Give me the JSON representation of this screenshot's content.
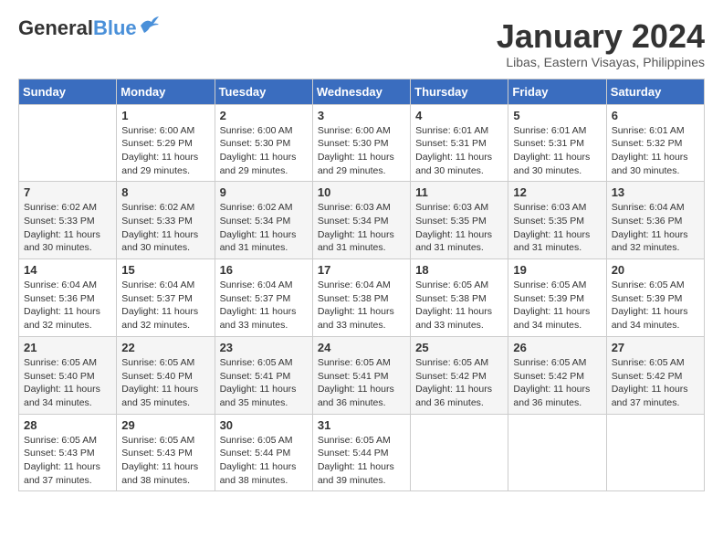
{
  "header": {
    "logo_general": "General",
    "logo_blue": "Blue",
    "month_title": "January 2024",
    "location": "Libas, Eastern Visayas, Philippines"
  },
  "weekdays": [
    "Sunday",
    "Monday",
    "Tuesday",
    "Wednesday",
    "Thursday",
    "Friday",
    "Saturday"
  ],
  "weeks": [
    [
      {
        "day": "",
        "info": ""
      },
      {
        "day": "1",
        "info": "Sunrise: 6:00 AM\nSunset: 5:29 PM\nDaylight: 11 hours\nand 29 minutes."
      },
      {
        "day": "2",
        "info": "Sunrise: 6:00 AM\nSunset: 5:30 PM\nDaylight: 11 hours\nand 29 minutes."
      },
      {
        "day": "3",
        "info": "Sunrise: 6:00 AM\nSunset: 5:30 PM\nDaylight: 11 hours\nand 29 minutes."
      },
      {
        "day": "4",
        "info": "Sunrise: 6:01 AM\nSunset: 5:31 PM\nDaylight: 11 hours\nand 30 minutes."
      },
      {
        "day": "5",
        "info": "Sunrise: 6:01 AM\nSunset: 5:31 PM\nDaylight: 11 hours\nand 30 minutes."
      },
      {
        "day": "6",
        "info": "Sunrise: 6:01 AM\nSunset: 5:32 PM\nDaylight: 11 hours\nand 30 minutes."
      }
    ],
    [
      {
        "day": "7",
        "info": "Sunrise: 6:02 AM\nSunset: 5:33 PM\nDaylight: 11 hours\nand 30 minutes."
      },
      {
        "day": "8",
        "info": "Sunrise: 6:02 AM\nSunset: 5:33 PM\nDaylight: 11 hours\nand 30 minutes."
      },
      {
        "day": "9",
        "info": "Sunrise: 6:02 AM\nSunset: 5:34 PM\nDaylight: 11 hours\nand 31 minutes."
      },
      {
        "day": "10",
        "info": "Sunrise: 6:03 AM\nSunset: 5:34 PM\nDaylight: 11 hours\nand 31 minutes."
      },
      {
        "day": "11",
        "info": "Sunrise: 6:03 AM\nSunset: 5:35 PM\nDaylight: 11 hours\nand 31 minutes."
      },
      {
        "day": "12",
        "info": "Sunrise: 6:03 AM\nSunset: 5:35 PM\nDaylight: 11 hours\nand 31 minutes."
      },
      {
        "day": "13",
        "info": "Sunrise: 6:04 AM\nSunset: 5:36 PM\nDaylight: 11 hours\nand 32 minutes."
      }
    ],
    [
      {
        "day": "14",
        "info": "Sunrise: 6:04 AM\nSunset: 5:36 PM\nDaylight: 11 hours\nand 32 minutes."
      },
      {
        "day": "15",
        "info": "Sunrise: 6:04 AM\nSunset: 5:37 PM\nDaylight: 11 hours\nand 32 minutes."
      },
      {
        "day": "16",
        "info": "Sunrise: 6:04 AM\nSunset: 5:37 PM\nDaylight: 11 hours\nand 33 minutes."
      },
      {
        "day": "17",
        "info": "Sunrise: 6:04 AM\nSunset: 5:38 PM\nDaylight: 11 hours\nand 33 minutes."
      },
      {
        "day": "18",
        "info": "Sunrise: 6:05 AM\nSunset: 5:38 PM\nDaylight: 11 hours\nand 33 minutes."
      },
      {
        "day": "19",
        "info": "Sunrise: 6:05 AM\nSunset: 5:39 PM\nDaylight: 11 hours\nand 34 minutes."
      },
      {
        "day": "20",
        "info": "Sunrise: 6:05 AM\nSunset: 5:39 PM\nDaylight: 11 hours\nand 34 minutes."
      }
    ],
    [
      {
        "day": "21",
        "info": "Sunrise: 6:05 AM\nSunset: 5:40 PM\nDaylight: 11 hours\nand 34 minutes."
      },
      {
        "day": "22",
        "info": "Sunrise: 6:05 AM\nSunset: 5:40 PM\nDaylight: 11 hours\nand 35 minutes."
      },
      {
        "day": "23",
        "info": "Sunrise: 6:05 AM\nSunset: 5:41 PM\nDaylight: 11 hours\nand 35 minutes."
      },
      {
        "day": "24",
        "info": "Sunrise: 6:05 AM\nSunset: 5:41 PM\nDaylight: 11 hours\nand 36 minutes."
      },
      {
        "day": "25",
        "info": "Sunrise: 6:05 AM\nSunset: 5:42 PM\nDaylight: 11 hours\nand 36 minutes."
      },
      {
        "day": "26",
        "info": "Sunrise: 6:05 AM\nSunset: 5:42 PM\nDaylight: 11 hours\nand 36 minutes."
      },
      {
        "day": "27",
        "info": "Sunrise: 6:05 AM\nSunset: 5:42 PM\nDaylight: 11 hours\nand 37 minutes."
      }
    ],
    [
      {
        "day": "28",
        "info": "Sunrise: 6:05 AM\nSunset: 5:43 PM\nDaylight: 11 hours\nand 37 minutes."
      },
      {
        "day": "29",
        "info": "Sunrise: 6:05 AM\nSunset: 5:43 PM\nDaylight: 11 hours\nand 38 minutes."
      },
      {
        "day": "30",
        "info": "Sunrise: 6:05 AM\nSunset: 5:44 PM\nDaylight: 11 hours\nand 38 minutes."
      },
      {
        "day": "31",
        "info": "Sunrise: 6:05 AM\nSunset: 5:44 PM\nDaylight: 11 hours\nand 39 minutes."
      },
      {
        "day": "",
        "info": ""
      },
      {
        "day": "",
        "info": ""
      },
      {
        "day": "",
        "info": ""
      }
    ]
  ]
}
